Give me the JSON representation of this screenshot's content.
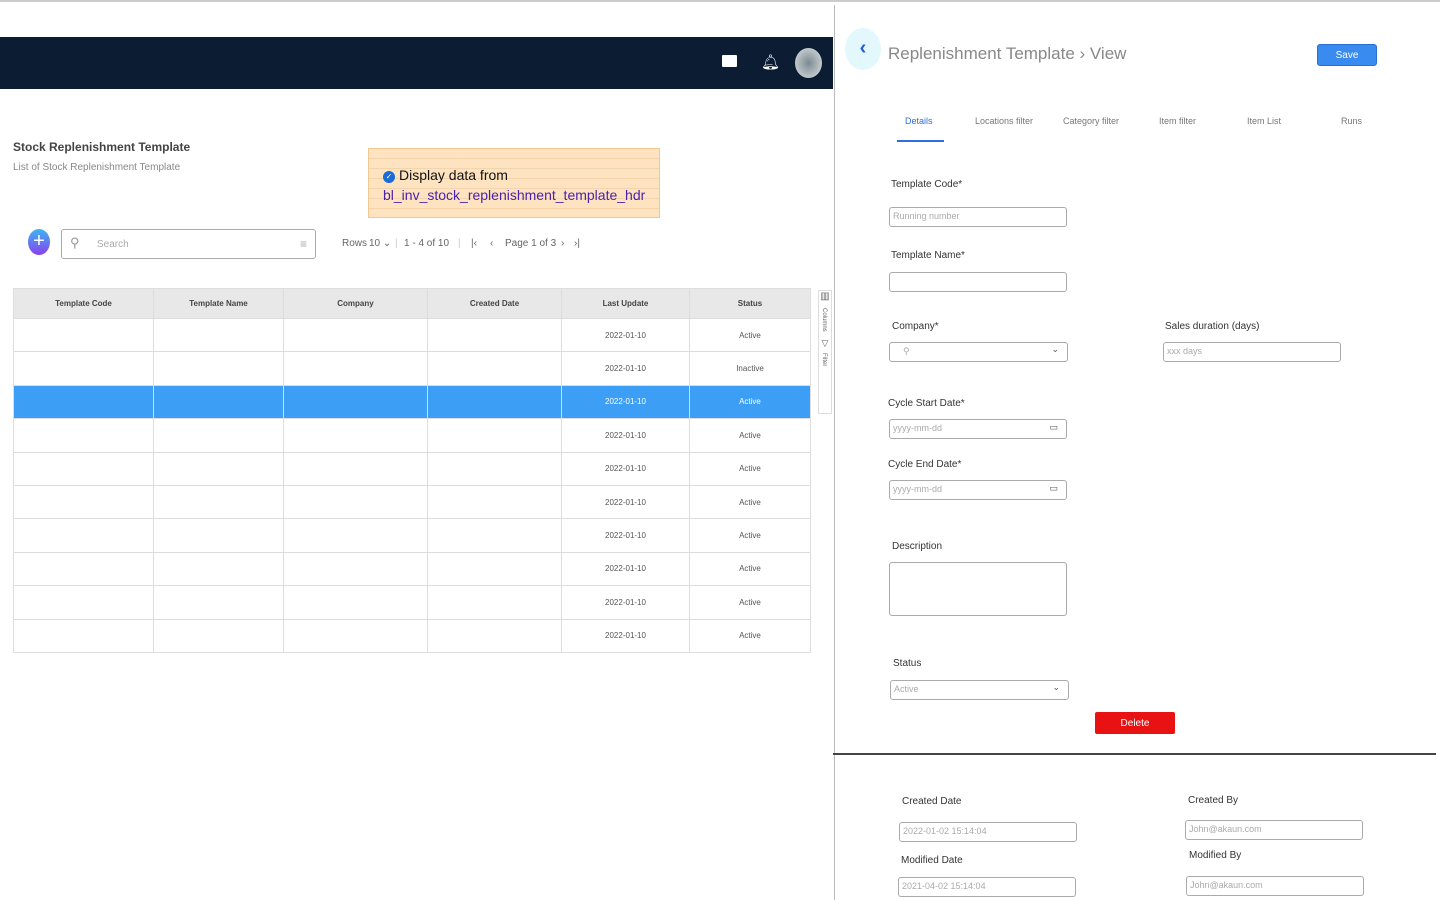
{
  "list": {
    "title": "Stock Replenishment Template",
    "subtitle": "List of Stock Replenishment  Template",
    "search_placeholder": "Search",
    "rows_label": "Rows",
    "rows_value": "10",
    "range": "1 - 4 of 10",
    "page": "Page 1 of 3",
    "columns": [
      "Template Code",
      "Template Name",
      "Company",
      "Created Date",
      "Last Update",
      "Status"
    ],
    "rows": [
      {
        "last_update": "2022-01-10",
        "status": "Active"
      },
      {
        "last_update": "2022-01-10",
        "status": "Inactive"
      },
      {
        "last_update": "2022-01-10",
        "status": "Active"
      },
      {
        "last_update": "2022-01-10",
        "status": "Active"
      },
      {
        "last_update": "2022-01-10",
        "status": "Active"
      },
      {
        "last_update": "2022-01-10",
        "status": "Active"
      },
      {
        "last_update": "2022-01-10",
        "status": "Active"
      },
      {
        "last_update": "2022-01-10",
        "status": "Active"
      },
      {
        "last_update": "2022-01-10",
        "status": "Active"
      },
      {
        "last_update": "2022-01-10",
        "status": "Active"
      }
    ],
    "side_columns": "Columns",
    "side_filter": "Filter"
  },
  "note": {
    "line1": "Display data from",
    "line2": "bl_inv_stock_replenishment_template_hdr"
  },
  "detail": {
    "title": "Replenishment Template › View",
    "save": "Save",
    "tabs": [
      "Details",
      "Locations filter",
      "Category filter",
      "Item filter",
      "Item List",
      "Runs"
    ],
    "template_code_label": "Template Code*",
    "template_code_placeholder": "Running number",
    "template_name_label": "Template Name*",
    "company_label": "Company*",
    "sales_duration_label": "Sales duration (days)",
    "sales_duration_placeholder": "xxx days",
    "cycle_start_label": "Cycle Start Date*",
    "cycle_end_label": "Cycle  End Date*",
    "date_placeholder": "yyyy-mm-dd",
    "description_label": "Description",
    "status_label": "Status",
    "status_value": "Active",
    "delete": "Delete",
    "created_date_label": "Created Date",
    "created_date": "2022-01-02 15:14:04",
    "modified_date_label": "Modified Date",
    "modified_date": "2021-04-02 15:14:04",
    "created_by_label": "Created By",
    "created_by": "John@akaun.com",
    "modified_by_label": "Modified By",
    "modified_by": "John@akaun.com"
  }
}
